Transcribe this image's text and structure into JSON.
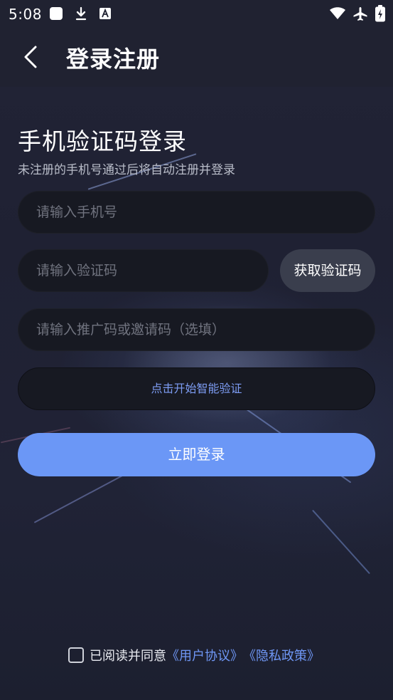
{
  "status_bar": {
    "time": "5:08",
    "left_icons": [
      "app-icon",
      "download-icon",
      "text-icon"
    ],
    "right_icons": [
      "wifi-icon",
      "airplane-icon",
      "battery-icon"
    ]
  },
  "app_bar": {
    "back_icon": "chevron-left-icon",
    "title": "登录注册"
  },
  "login": {
    "heading": "手机验证码登录",
    "subheading": "未注册的手机号通过后将自动注册并登录",
    "phone_placeholder": "请输入手机号",
    "code_placeholder": "请输入验证码",
    "get_code_label": "获取验证码",
    "invite_placeholder": "请输入推广码或邀请码（选填）",
    "verify_label": "点击开始智能验证",
    "submit_label": "立即登录"
  },
  "agreement": {
    "prefix": "已阅读并同意",
    "user_agreement": "《用户协议》",
    "privacy_policy": "《隐私政策》"
  },
  "colors": {
    "background": "#1f2233",
    "field": "#171922",
    "accent": "#6b97f6",
    "link": "#6f97f5"
  }
}
